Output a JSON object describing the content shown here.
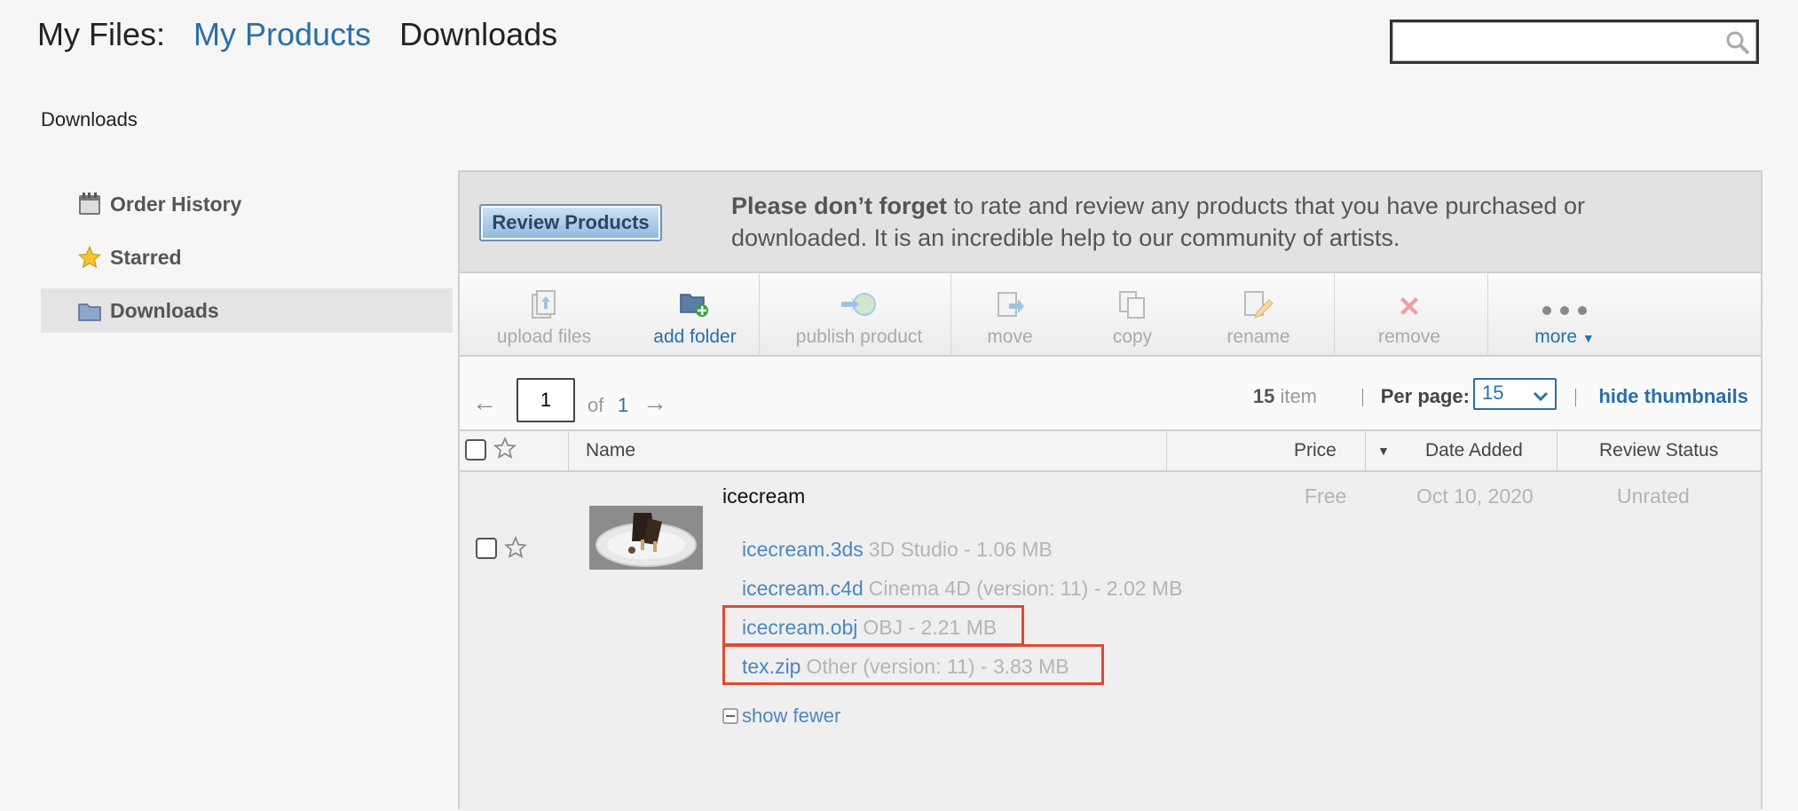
{
  "header": {
    "label": "My Files:",
    "my_products": "My Products",
    "current": "Downloads"
  },
  "search": {
    "placeholder": ""
  },
  "breadcrumb": "Downloads",
  "sidebar": {
    "items": [
      {
        "label": "Order History",
        "icon": "calendar-icon"
      },
      {
        "label": "Starred",
        "icon": "star-icon"
      },
      {
        "label": "Downloads",
        "icon": "folder-icon",
        "active": true
      }
    ]
  },
  "notice": {
    "button": "Review Products",
    "bold": "Please don’t forget",
    "text": " to rate and review any products that you have purchased or downloaded. It is an incredible help to our community of artists."
  },
  "toolbar": {
    "upload": "upload files",
    "add_folder": "add folder",
    "publish": "publish product",
    "move": "move",
    "copy": "copy",
    "rename": "rename",
    "remove": "remove",
    "more": "more"
  },
  "pager": {
    "page": "1",
    "of": "of",
    "total": "1",
    "count": "15",
    "count_unit": "item",
    "per_page_label": "Per page:",
    "per_page": "15",
    "hide_thumbnails": "hide thumbnails"
  },
  "columns": {
    "name": "Name",
    "price": "Price",
    "date": "Date Added",
    "review": "Review Status"
  },
  "product": {
    "title": "icecream",
    "price": "Free",
    "date": "Oct 10, 2020",
    "review": "Unrated",
    "files": [
      {
        "name": "icecream.3ds",
        "meta": "3D Studio  - 1.06 MB"
      },
      {
        "name": "icecream.c4d",
        "meta": "Cinema 4D  (version: 11) - 2.02 MB"
      },
      {
        "name": "icecream.obj",
        "meta": "OBJ  - 2.21 MB"
      },
      {
        "name": "tex.zip",
        "meta": "Other  (version: 11) - 3.83 MB"
      }
    ],
    "show_fewer": "show fewer"
  },
  "colors": {
    "link": "#2a6fa8",
    "highlight": "#e04a34"
  }
}
